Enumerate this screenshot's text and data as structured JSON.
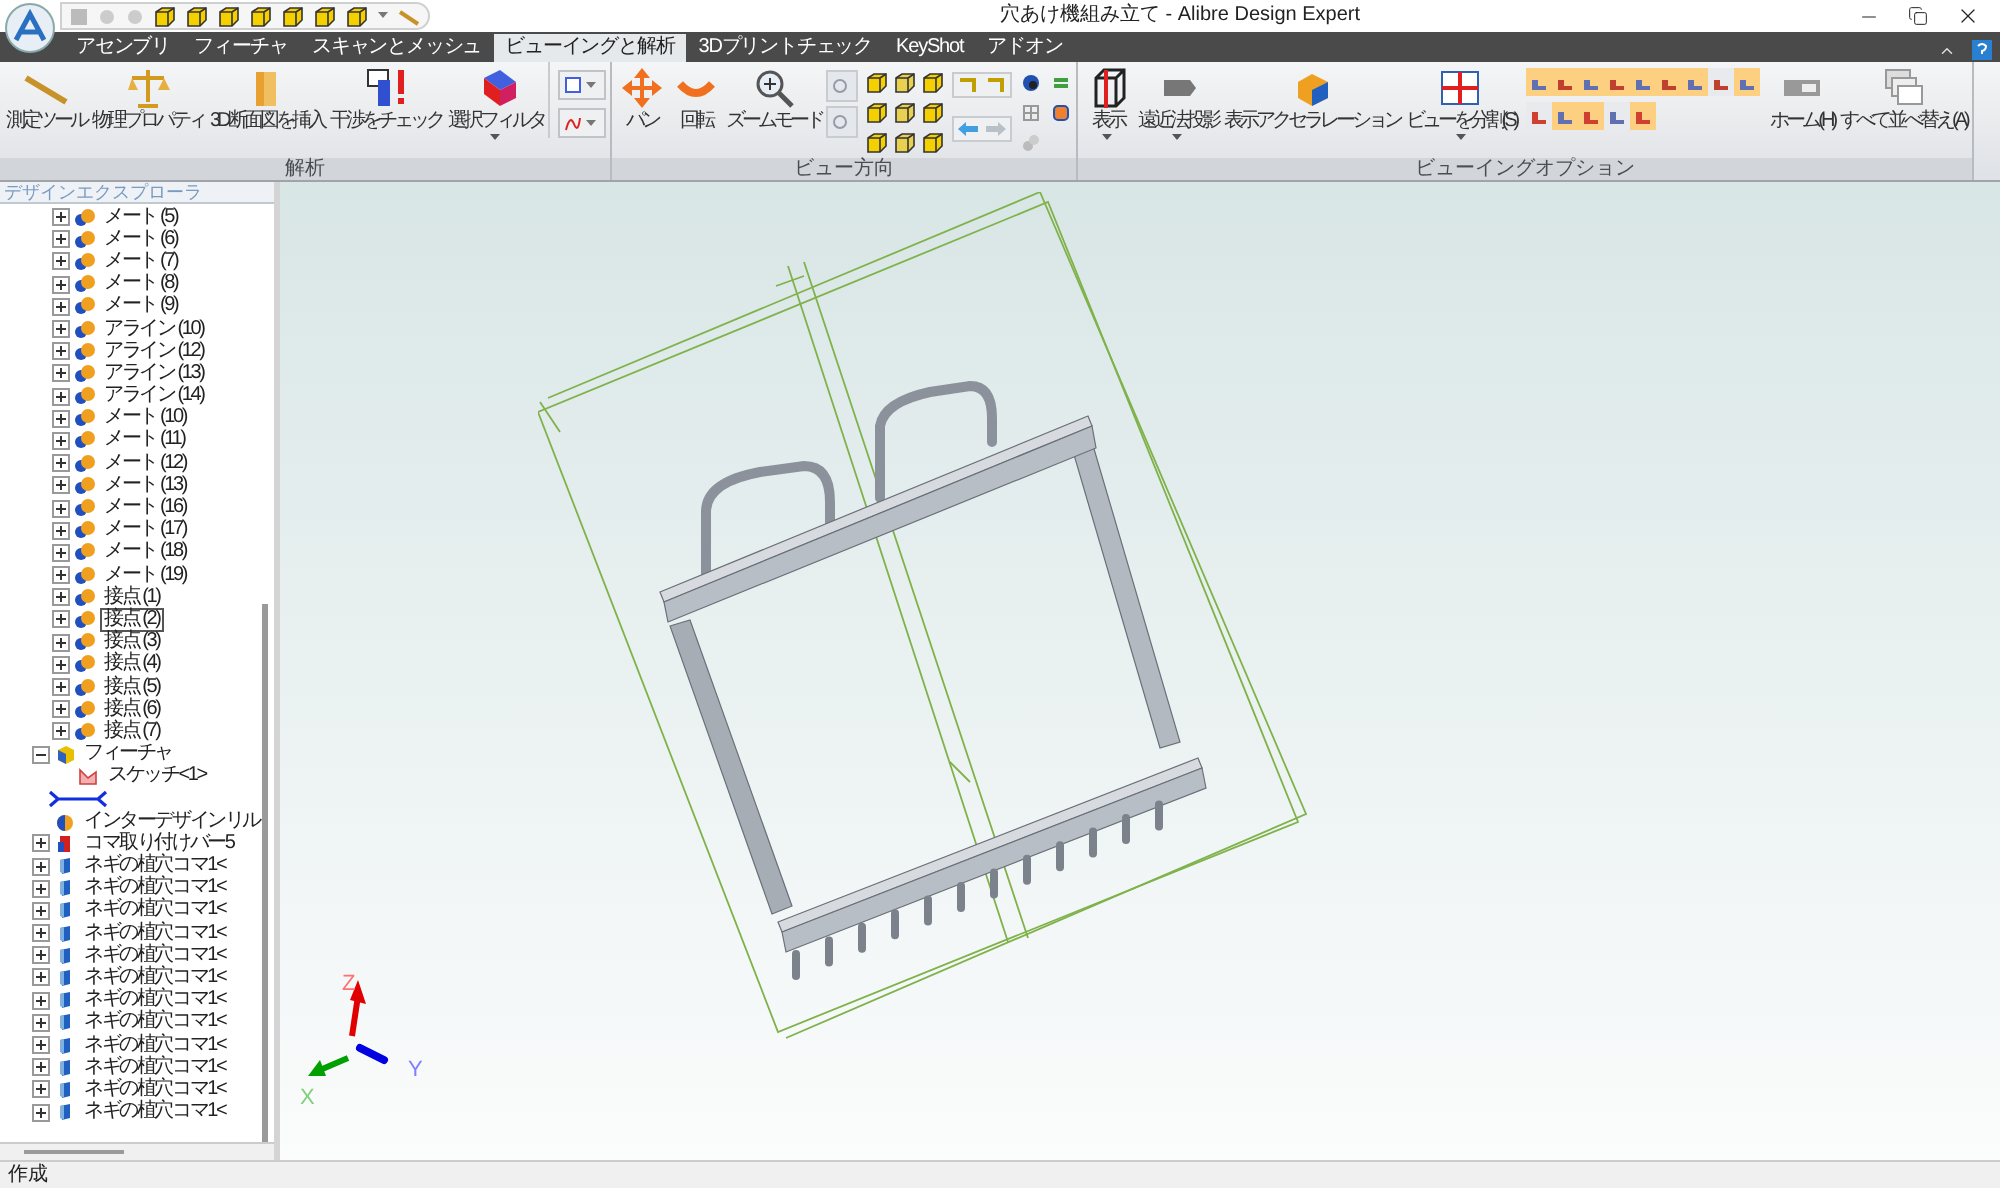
{
  "window": {
    "title": "穴あけ機組み立て - Alibre Design Expert"
  },
  "ribbon_tabs": [
    {
      "label": "アセンブリ",
      "selected": false
    },
    {
      "label": "フィーチャ",
      "selected": false
    },
    {
      "label": "スキャンとメッシュ",
      "selected": false
    },
    {
      "label": "ビューイングと解析",
      "selected": true
    },
    {
      "label": "3Dプリントチェック",
      "selected": false
    },
    {
      "label": "KeyShot",
      "selected": false
    },
    {
      "label": "アドオン",
      "selected": false
    }
  ],
  "ribbon_groups": [
    {
      "label": "解析",
      "items": [
        {
          "kind": "large",
          "label": "測定ツール",
          "dropdown": false
        },
        {
          "kind": "large",
          "label": "物理プロパティ",
          "dropdown": false
        },
        {
          "kind": "large",
          "label": "3D断面図を挿入",
          "dropdown": false
        },
        {
          "kind": "large",
          "label": "干渉をチェック",
          "dropdown": false
        },
        {
          "kind": "large",
          "label": "選択フィルタ",
          "dropdown": true
        },
        {
          "kind": "small_dropdowns"
        }
      ]
    },
    {
      "label": "ビュー方向",
      "items": [
        {
          "kind": "large",
          "label": "パン",
          "dropdown": false
        },
        {
          "kind": "large",
          "label": "回転",
          "dropdown": false
        },
        {
          "kind": "large",
          "label": "ズームモード",
          "dropdown": false
        },
        {
          "kind": "view_grid"
        }
      ]
    },
    {
      "label": "ビューイングオプション",
      "items": [
        {
          "kind": "large",
          "label": "表示",
          "dropdown": true
        },
        {
          "kind": "large",
          "label": "遠近法投影",
          "dropdown": true
        },
        {
          "kind": "large",
          "label": "表示アクセラレーション",
          "dropdown": false
        },
        {
          "kind": "large",
          "label": "ビューを分割(S)",
          "dropdown": true
        },
        {
          "kind": "option_grid"
        },
        {
          "kind": "large",
          "label": "ホーム(H)",
          "dropdown": false
        },
        {
          "kind": "large",
          "label": "すべて並べ替え(A)",
          "dropdown": false
        }
      ]
    }
  ],
  "explorer": {
    "title": "デザインエクスプローラ",
    "branch_items": [
      {
        "label": "メート (5)",
        "kind": "mate",
        "expanded": false,
        "selected": false
      },
      {
        "label": "メート (6)",
        "kind": "mate",
        "expanded": false,
        "selected": false
      },
      {
        "label": "メート (7)",
        "kind": "mate",
        "expanded": false,
        "selected": false
      },
      {
        "label": "メート (8)",
        "kind": "mate",
        "expanded": false,
        "selected": false
      },
      {
        "label": "メート (9)",
        "kind": "mate",
        "expanded": false,
        "selected": false
      },
      {
        "label": "アライン (10)",
        "kind": "mate",
        "expanded": false,
        "selected": false
      },
      {
        "label": "アライン (12)",
        "kind": "mate",
        "expanded": false,
        "selected": false
      },
      {
        "label": "アライン (13)",
        "kind": "mate",
        "expanded": false,
        "selected": false
      },
      {
        "label": "アライン (14)",
        "kind": "mate",
        "expanded": false,
        "selected": false
      },
      {
        "label": "メート (10)",
        "kind": "mate",
        "expanded": false,
        "selected": false
      },
      {
        "label": "メート (11)",
        "kind": "mate",
        "expanded": false,
        "selected": false
      },
      {
        "label": "メート (12)",
        "kind": "mate",
        "expanded": false,
        "selected": false
      },
      {
        "label": "メート (13)",
        "kind": "mate",
        "expanded": false,
        "selected": false
      },
      {
        "label": "メート (16)",
        "kind": "mate",
        "expanded": false,
        "selected": false
      },
      {
        "label": "メート (17)",
        "kind": "mate",
        "expanded": false,
        "selected": false
      },
      {
        "label": "メート (18)",
        "kind": "mate",
        "expanded": false,
        "selected": false
      },
      {
        "label": "メート (19)",
        "kind": "mate",
        "expanded": false,
        "selected": false
      },
      {
        "label": "接点 (1)",
        "kind": "mate",
        "expanded": false,
        "selected": false
      },
      {
        "label": "接点 (2)",
        "kind": "mate",
        "expanded": false,
        "selected": true
      },
      {
        "label": "接点 (3)",
        "kind": "mate",
        "expanded": false,
        "selected": false
      },
      {
        "label": "接点 (4)",
        "kind": "mate",
        "expanded": false,
        "selected": false
      },
      {
        "label": "接点 (5)",
        "kind": "mate",
        "expanded": false,
        "selected": false
      },
      {
        "label": "接点 (6)",
        "kind": "mate",
        "expanded": false,
        "selected": false
      },
      {
        "label": "接点 (7)",
        "kind": "mate",
        "expanded": false,
        "selected": false
      }
    ],
    "items": [
      {
        "label": "フィーチャ",
        "kind": "feature",
        "expanded": true,
        "selected": false,
        "children": [
          {
            "label": "スケッチ<1>",
            "kind": "sketch",
            "selected": false
          }
        ]
      },
      {
        "kind": "marker",
        "selected": false
      },
      {
        "label": "インターデザインリル",
        "kind": "design",
        "selected": false
      },
      {
        "label": "コマ取り付けバー5",
        "kind": "part_red",
        "expanded": false,
        "selected": false
      },
      {
        "label": "ネギの植穴コマ1<",
        "kind": "part",
        "expanded": false,
        "selected": false
      },
      {
        "label": "ネギの植穴コマ1<",
        "kind": "part",
        "expanded": false,
        "selected": false
      },
      {
        "label": "ネギの植穴コマ1<",
        "kind": "part",
        "expanded": false,
        "selected": false
      },
      {
        "label": "ネギの植穴コマ1<",
        "kind": "part",
        "expanded": false,
        "selected": false
      },
      {
        "label": "ネギの植穴コマ1<",
        "kind": "part",
        "expanded": false,
        "selected": false
      },
      {
        "label": "ネギの植穴コマ1<",
        "kind": "part",
        "expanded": false,
        "selected": false
      },
      {
        "label": "ネギの植穴コマ1<",
        "kind": "part",
        "expanded": false,
        "selected": false
      },
      {
        "label": "ネギの植穴コマ1<",
        "kind": "part",
        "expanded": false,
        "selected": false
      },
      {
        "label": "ネギの植穴コマ1<",
        "kind": "part",
        "expanded": false,
        "selected": false
      },
      {
        "label": "ネギの植穴コマ1<",
        "kind": "part",
        "expanded": false,
        "selected": false
      },
      {
        "label": "ネギの植穴コマ1<",
        "kind": "part",
        "expanded": false,
        "selected": false
      },
      {
        "label": "ネギの植穴コマ1<",
        "kind": "part",
        "expanded": false,
        "selected": false
      }
    ]
  },
  "viewport": {
    "axes": [
      {
        "label": "Z",
        "kind": "z"
      },
      {
        "label": "X",
        "kind": "x"
      },
      {
        "label": "Y",
        "kind": "y"
      }
    ]
  },
  "status_bar": {
    "text": "作成"
  }
}
